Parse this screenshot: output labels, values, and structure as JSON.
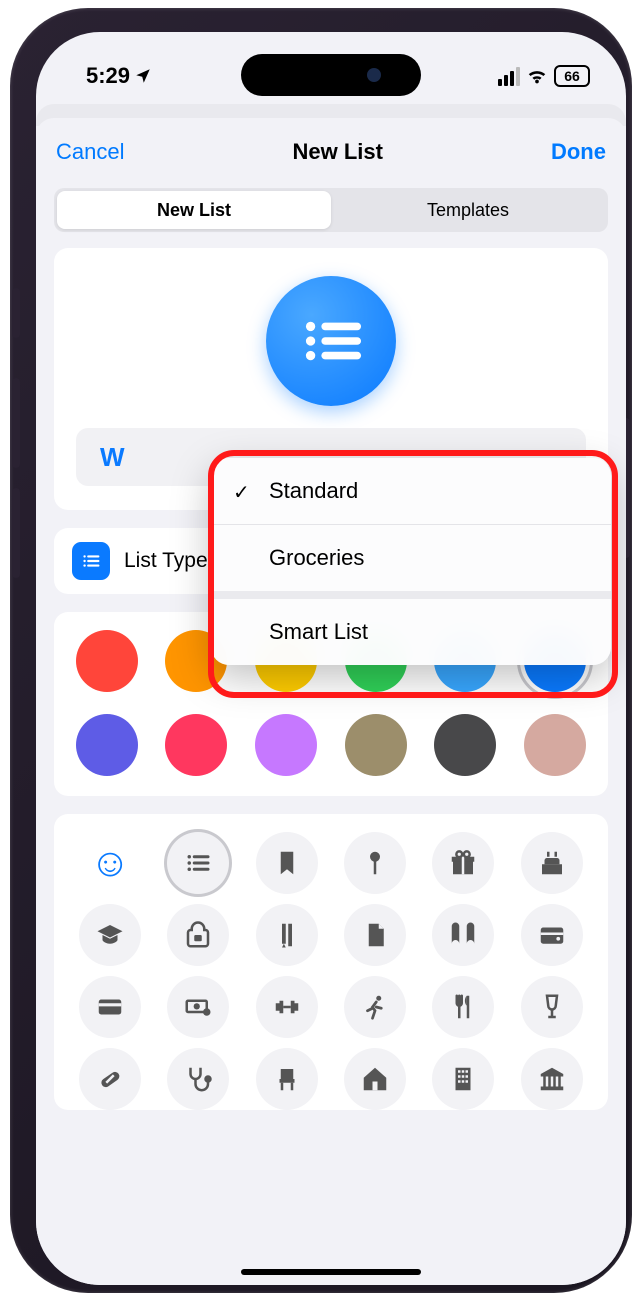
{
  "status": {
    "time": "5:29",
    "battery": "66"
  },
  "nav": {
    "cancel": "Cancel",
    "title": "New List",
    "done": "Done"
  },
  "segmented": {
    "newlist": "New List",
    "templates": "Templates"
  },
  "hero": {
    "listname_partial": "W"
  },
  "listtype": {
    "label": "List Type",
    "value": "Standard"
  },
  "popup": {
    "options": [
      {
        "label": "Standard",
        "checked": true
      },
      {
        "label": "Groceries",
        "checked": false
      },
      {
        "label": "Smart List",
        "checked": false
      }
    ]
  },
  "colors": [
    "#ff453a",
    "#ff9500",
    "#ffcc00",
    "#30d158",
    "#38a7ff",
    "#0a7aff",
    "#5e5ce6",
    "#ff375f",
    "#c678ff",
    "#9c8e6b",
    "#48484a",
    "#d5a9a0"
  ],
  "selected_color_index": 5,
  "icon_names": [
    "emoji-picker",
    "list-bullet",
    "bookmark-icon",
    "pin-icon",
    "gift-icon",
    "cake-icon",
    "graduation-icon",
    "backpack-icon",
    "pencil-ruler-icon",
    "document-icon",
    "book-icon",
    "wallet-icon",
    "card-icon",
    "cash-icon",
    "dumbbell-icon",
    "running-icon",
    "fork-knife-icon",
    "wineglass-icon",
    "pill-icon",
    "stethoscope-icon",
    "chair-icon",
    "house-icon",
    "building-icon",
    "bank-icon"
  ],
  "selected_icon_index": 1
}
